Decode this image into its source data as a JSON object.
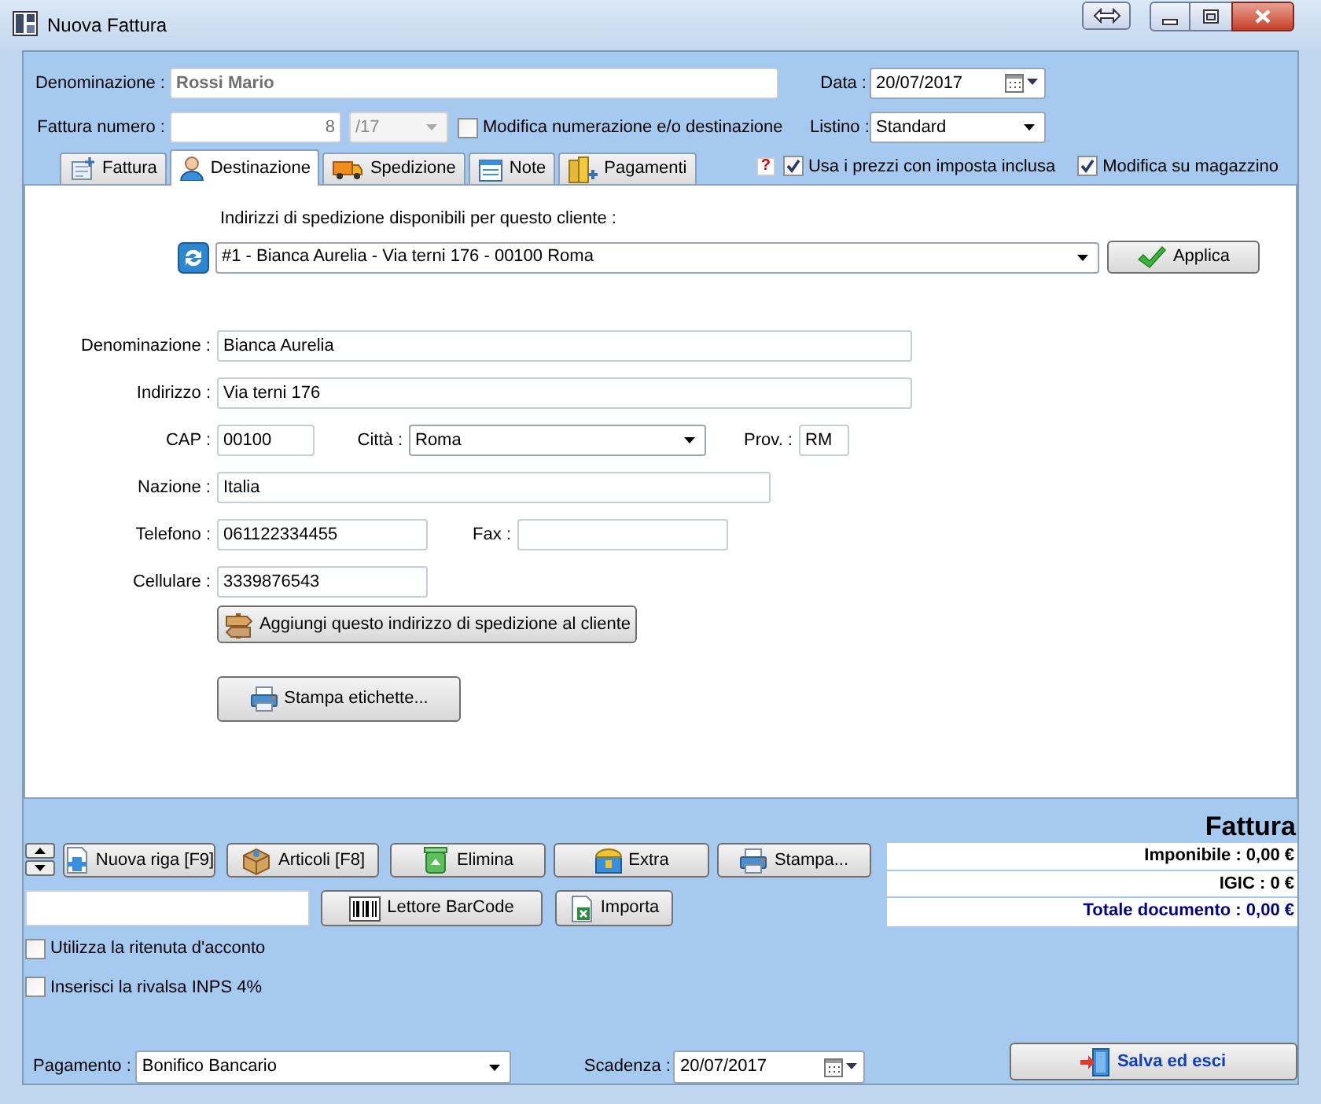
{
  "window": {
    "title": "Nuova Fattura"
  },
  "header": {
    "denominazione": {
      "label": "Denominazione :",
      "value": "Rossi Mario"
    },
    "data": {
      "label": "Data :",
      "value": "20/07/2017"
    },
    "fattura_numero": {
      "label": "Fattura numero :",
      "value": "8",
      "suffix": "/17"
    },
    "modifica_numerazione": {
      "label": "Modifica numerazione e/o destinazione",
      "checked": false
    },
    "listino": {
      "label": "Listino :",
      "value": "Standard"
    }
  },
  "tabs": [
    {
      "label": "Fattura",
      "selected": false
    },
    {
      "label": "Destinazione",
      "selected": true
    },
    {
      "label": "Spedizione",
      "selected": false
    },
    {
      "label": "Note",
      "selected": false
    },
    {
      "label": "Pagamenti",
      "selected": false
    }
  ],
  "tab_options": [
    {
      "label": "Usa i prezzi con imposta inclusa",
      "checked": true,
      "help": "?"
    },
    {
      "label": "Modifica su magazzino",
      "checked": true
    }
  ],
  "destinazione": {
    "addresses_label": "Indirizzi di spedizione disponibili per questo cliente :",
    "address": "#1 - Bianca Aurelia - Via terni 176 - 00100 Roma",
    "apply_button": "Applica",
    "rows": [
      [
        {
          "kind": "text",
          "label": "Denominazione :",
          "value": "Bianca Aurelia"
        }
      ],
      [
        {
          "kind": "text",
          "label": "Indirizzo :",
          "value": "Via terni 176"
        }
      ],
      [
        {
          "kind": "text",
          "label": "CAP :",
          "value": "00100"
        },
        {
          "kind": "combo",
          "label": "Città :",
          "value": "Roma"
        },
        {
          "kind": "text",
          "label": "Prov. :",
          "value": "RM"
        }
      ],
      [
        {
          "kind": "text",
          "label": "Nazione :",
          "value": "Italia"
        }
      ],
      [
        {
          "kind": "text",
          "label": "Telefono :",
          "value": "061122334455"
        },
        {
          "kind": "text",
          "label": "Fax :"
        }
      ],
      [
        {
          "kind": "text",
          "label": "Cellulare :",
          "value": "3339876543"
        }
      ]
    ],
    "add_button": "Aggiungi questo indirizzo di spedizione al cliente",
    "print_labels_button": "Stampa etichette..."
  },
  "invoice": {
    "title": "Fattura",
    "toolbar": [
      "Nuova riga [F9]",
      "Articoli [F8]",
      "Elimina",
      "Extra",
      "Stampa..."
    ],
    "barcode_button": "Lettore BarCode",
    "import_button": "Importa",
    "totals": [
      {
        "kind": "line",
        "label": "Imponibile : 0,00 €"
      },
      {
        "kind": "line",
        "label": "IGIC : 0 €"
      },
      {
        "kind": "total",
        "label": "Totale documento : 0,00 €"
      }
    ],
    "options": [
      {
        "label": "Utilizza la ritenuta d'acconto",
        "checked": false
      },
      {
        "label": "Inserisci la rivalsa INPS 4%",
        "checked": false
      }
    ],
    "pagamento": {
      "label": "Pagamento :",
      "value": "Bonifico Bancario"
    },
    "scadenza": {
      "label": "Scadenza :",
      "value": "20/07/2017"
    },
    "save_button": "Salva ed esci"
  }
}
